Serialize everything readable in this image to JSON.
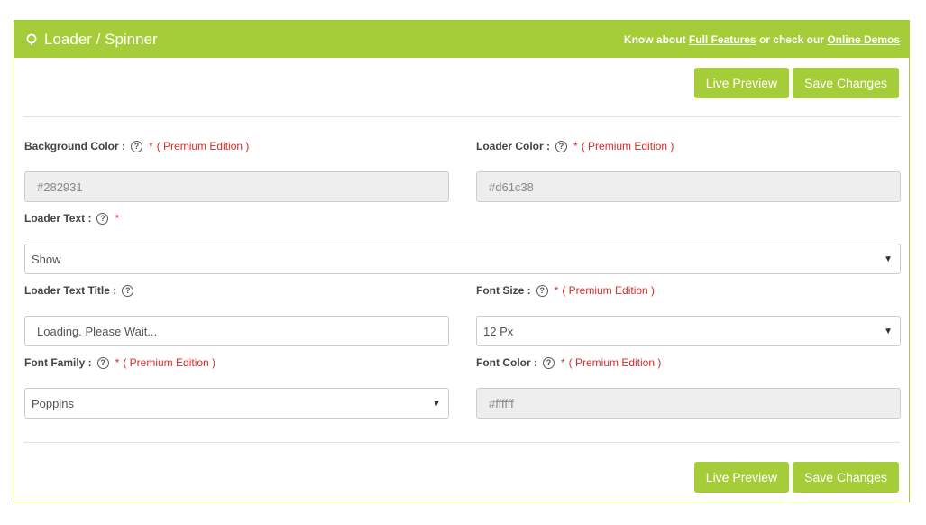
{
  "header": {
    "title": "Loader / Spinner",
    "links_prefix": "Know about ",
    "full_features": "Full Features",
    "links_middle": " or check our ",
    "online_demos": "Online Demos"
  },
  "buttons": {
    "live_preview": "Live Preview",
    "save_changes": "Save Changes"
  },
  "fields": {
    "background_color": {
      "label": "Background Color :",
      "required": "*",
      "note": "( Premium Edition )",
      "value": "#282931"
    },
    "loader_color": {
      "label": "Loader Color :",
      "required": "*",
      "note": "( Premium Edition )",
      "value": "#d61c38"
    },
    "loader_text": {
      "label": "Loader Text :",
      "required": "*",
      "value": "Show"
    },
    "loader_text_title": {
      "label": "Loader Text Title :",
      "value": "Loading. Please Wait..."
    },
    "font_size": {
      "label": "Font Size :",
      "required": "*",
      "note": "( Premium Edition )",
      "value": "12 Px"
    },
    "font_family": {
      "label": "Font Family :",
      "required": "*",
      "note": "( Premium Edition )",
      "value": "Poppins"
    },
    "font_color": {
      "label": "Font Color :",
      "required": "*",
      "note": "( Premium Edition )",
      "value": "#ffffff"
    }
  },
  "icons": {
    "help": "help-icon",
    "title": "spinner-icon",
    "select": "caret-down-icon"
  },
  "colors": {
    "accent": "#a4cd39",
    "required": "#d62b2b",
    "disabled_bg": "#eeeeee"
  }
}
